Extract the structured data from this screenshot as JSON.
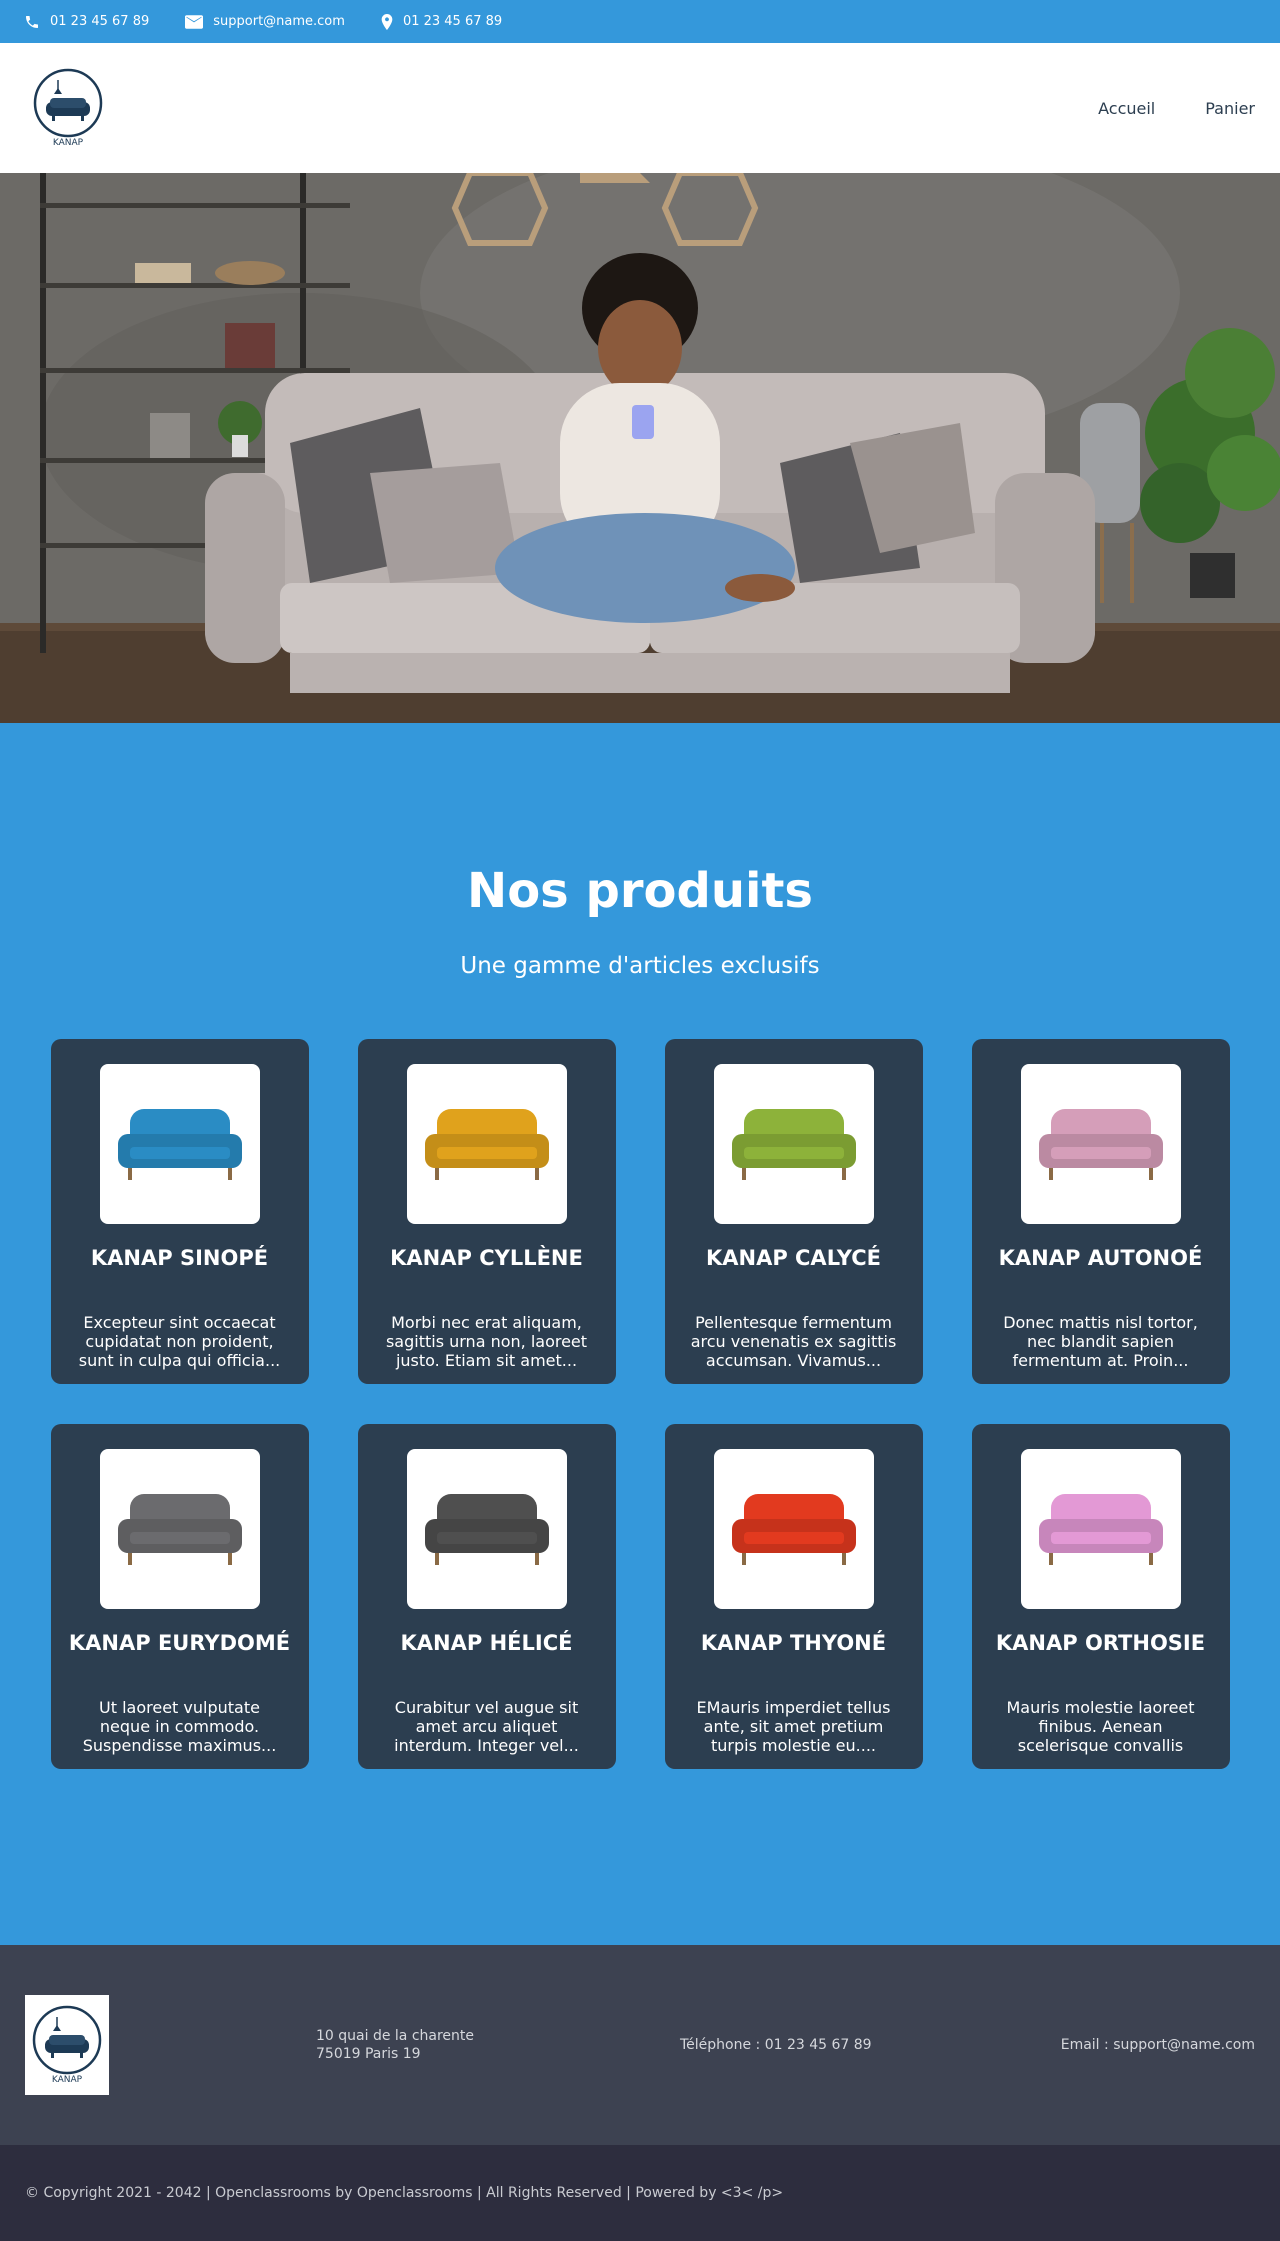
{
  "topbar": {
    "phone": "01 23 45 67 89",
    "email": "support@name.com",
    "location": "01 23 45 67 89"
  },
  "header": {
    "logo_text": "KANAP",
    "nav": [
      "Accueil",
      "Panier"
    ]
  },
  "products": {
    "title": "Nos produits",
    "subtitle": "Une gamme d'articles exclusifs",
    "items": [
      {
        "name": "KANAP SINOPÉ",
        "desc": "Excepteur sint occaecat cupidatat non proident, sunt in culpa qui officia...",
        "color": "#2a8cc4"
      },
      {
        "name": "KANAP CYLLÈNE",
        "desc": "Morbi nec erat aliquam, sagittis urna non, laoreet justo. Etiam sit amet...",
        "color": "#e0a21c"
      },
      {
        "name": "KANAP CALYCÉ",
        "desc": "Pellentesque fermentum arcu venenatis ex sagittis accumsan. Vivamus...",
        "color": "#8db23a"
      },
      {
        "name": "KANAP AUTONOÉ",
        "desc": "Donec mattis nisl tortor, nec blandit sapien fermentum at. Proin...",
        "color": "#d59eb9"
      },
      {
        "name": "KANAP EURYDOMÉ",
        "desc": "Ut laoreet vulputate neque in commodo. Suspendisse maximus...",
        "color": "#6b6b6e"
      },
      {
        "name": "KANAP HÉLICÉ",
        "desc": "Curabitur vel augue sit amet arcu aliquet interdum. Integer vel...",
        "color": "#4f4f4f"
      },
      {
        "name": "KANAP THYONÉ",
        "desc": "EMauris imperdiet tellus ante, sit amet pretium turpis molestie eu....",
        "color": "#e23a1f"
      },
      {
        "name": "KANAP ORTHOSIE",
        "desc": "Mauris molestie laoreet finibus. Aenean scelerisque convallis lacu...",
        "color": "#e399d5"
      }
    ]
  },
  "footer": {
    "logo_text": "KANAP",
    "address_line1": "10 quai de la charente",
    "address_line2": "75019 Paris 19",
    "telephone": "Téléphone : 01 23 45 67 89",
    "email": "Email : support@name.com",
    "copyright": "© Copyright 2021 - 2042 | Openclassrooms by Openclassrooms | All Rights Reserved | Powered by <3< /p>"
  }
}
